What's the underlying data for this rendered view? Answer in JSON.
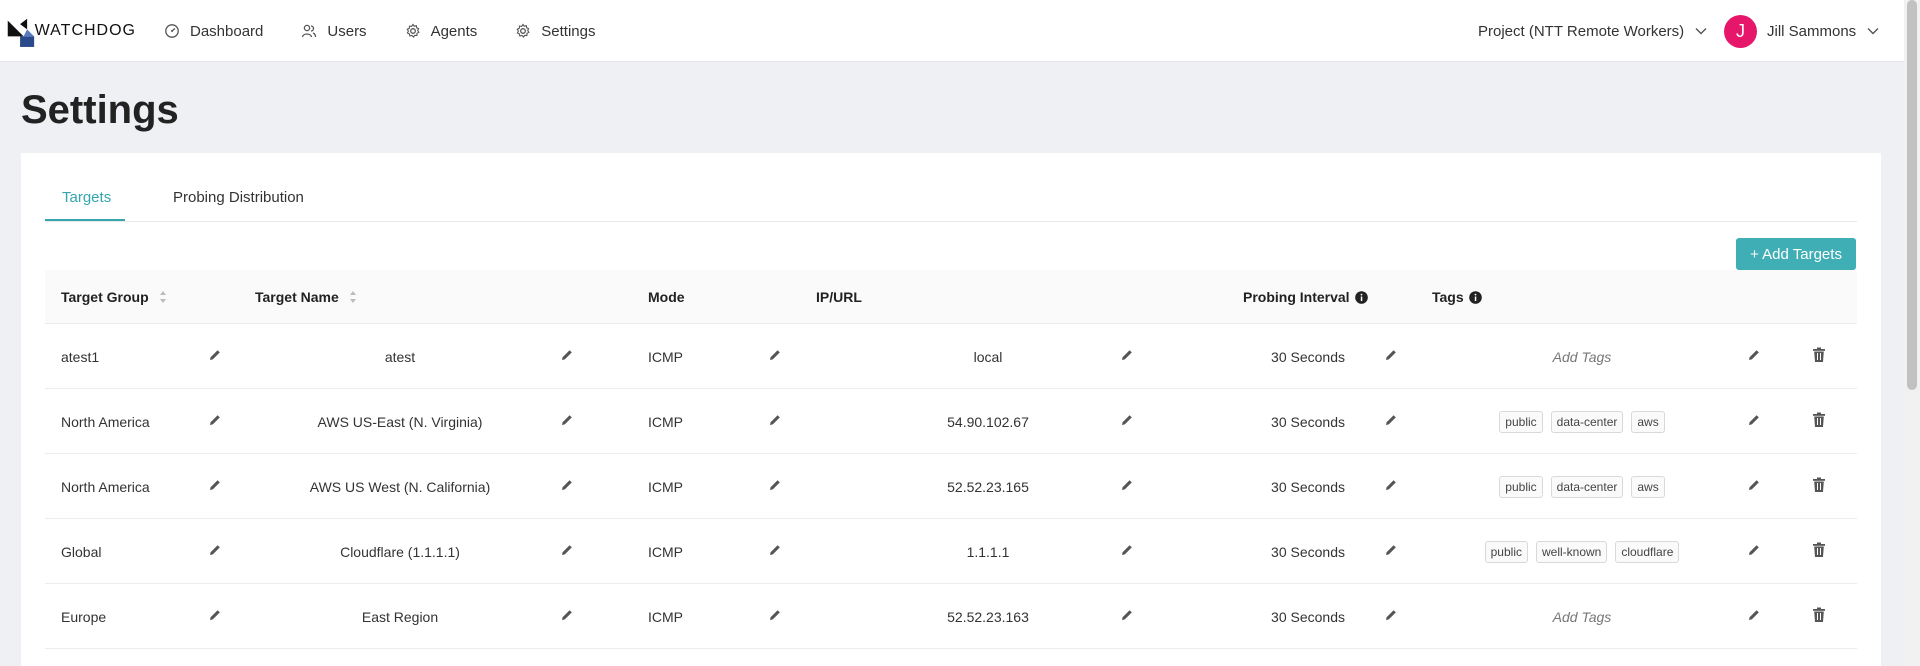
{
  "app": {
    "logo_text": "WATCHDOG"
  },
  "nav": {
    "items": [
      {
        "label": "Dashboard",
        "icon": "dashboard-icon"
      },
      {
        "label": "Users",
        "icon": "users-icon"
      },
      {
        "label": "Agents",
        "icon": "agents-gear-icon"
      },
      {
        "label": "Settings",
        "icon": "settings-gear-icon"
      }
    ],
    "project": "Project (NTT Remote Workers)",
    "user_initial": "J",
    "user_name": "Jill Sammons"
  },
  "page": {
    "title": "Settings"
  },
  "tabs": {
    "items": [
      "Targets",
      "Probing Distribution"
    ],
    "active": "Targets"
  },
  "toolbar": {
    "add_targets_label": "+ Add Targets"
  },
  "table": {
    "headers": {
      "target_group": "Target Group",
      "target_name": "Target Name",
      "mode": "Mode",
      "ip_url": "IP/URL",
      "probing_interval": "Probing Interval",
      "tags": "Tags"
    },
    "add_tags_label": "Add Tags",
    "rows": [
      {
        "group": "atest1",
        "name": "atest",
        "mode": "ICMP",
        "ip": "local",
        "interval": "30 Seconds",
        "tags": []
      },
      {
        "group": "North America",
        "name": "AWS US-East (N. Virginia)",
        "mode": "ICMP",
        "ip": "54.90.102.67",
        "interval": "30 Seconds",
        "tags": [
          "public",
          "data-center",
          "aws"
        ]
      },
      {
        "group": "North America",
        "name": "AWS US West (N. California)",
        "mode": "ICMP",
        "ip": "52.52.23.165",
        "interval": "30 Seconds",
        "tags": [
          "public",
          "data-center",
          "aws"
        ]
      },
      {
        "group": "Global",
        "name": "Cloudflare (1.1.1.1)",
        "mode": "ICMP",
        "ip": "1.1.1.1",
        "interval": "30 Seconds",
        "tags": [
          "public",
          "well-known",
          "cloudflare"
        ]
      },
      {
        "group": "Europe",
        "name": "East Region",
        "mode": "ICMP",
        "ip": "52.52.23.163",
        "interval": "30 Seconds",
        "tags": []
      }
    ]
  },
  "colors": {
    "accent": "#3fafb5",
    "avatar": "#e6176b",
    "logo_blue": "#2b4a8c"
  }
}
